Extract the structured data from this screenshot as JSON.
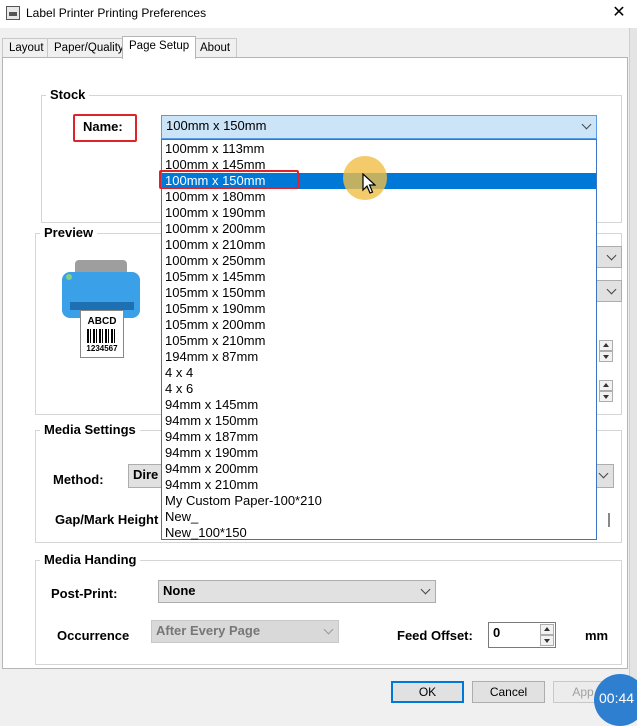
{
  "window": {
    "title": "Label Printer Printing Preferences",
    "close": "✕"
  },
  "tabs": [
    {
      "label": "Layout"
    },
    {
      "label": "Paper/Quality"
    },
    {
      "label": "Page Setup"
    },
    {
      "label": "About"
    }
  ],
  "stock": {
    "legend": "Stock",
    "name_label": "Name:",
    "selected": "100mm x 150mm",
    "options": [
      "100mm x 113mm",
      "100mm x 145mm",
      "100mm x 150mm",
      "100mm x 180mm",
      "100mm x 190mm",
      "100mm x 200mm",
      "100mm x 210mm",
      "100mm x 250mm",
      "105mm x 145mm",
      "105mm x 150mm",
      "105mm x 190mm",
      "105mm x 200mm",
      "105mm x 210mm",
      "194mm x 87mm",
      "4 x 4",
      "4 x 6",
      "94mm x 145mm",
      "94mm x 150mm",
      "94mm x 187mm",
      "94mm x 190mm",
      "94mm x 200mm",
      "94mm x 210mm",
      "My Custom Paper-100*210",
      "New_",
      "New_100*150"
    ]
  },
  "preview": {
    "legend": "Preview",
    "label_text": "ABCD",
    "barcode_number": "1234567"
  },
  "media_settings": {
    "legend": "Media Settings",
    "method_label": "Method:",
    "method_value": "Dire",
    "gap_label": "Gap/Mark Height"
  },
  "media_handling": {
    "legend": "Media Handing",
    "post_print_label": "Post-Print:",
    "post_print_value": "None",
    "occurrence_label": "Occurrence",
    "occurrence_value": "After Every Page",
    "feed_offset_label": "Feed Offset:",
    "feed_offset_value": "0",
    "feed_offset_unit": "mm"
  },
  "buttons": {
    "ok": "OK",
    "cancel": "Cancel",
    "apply": "App"
  },
  "timer": "00:44"
}
